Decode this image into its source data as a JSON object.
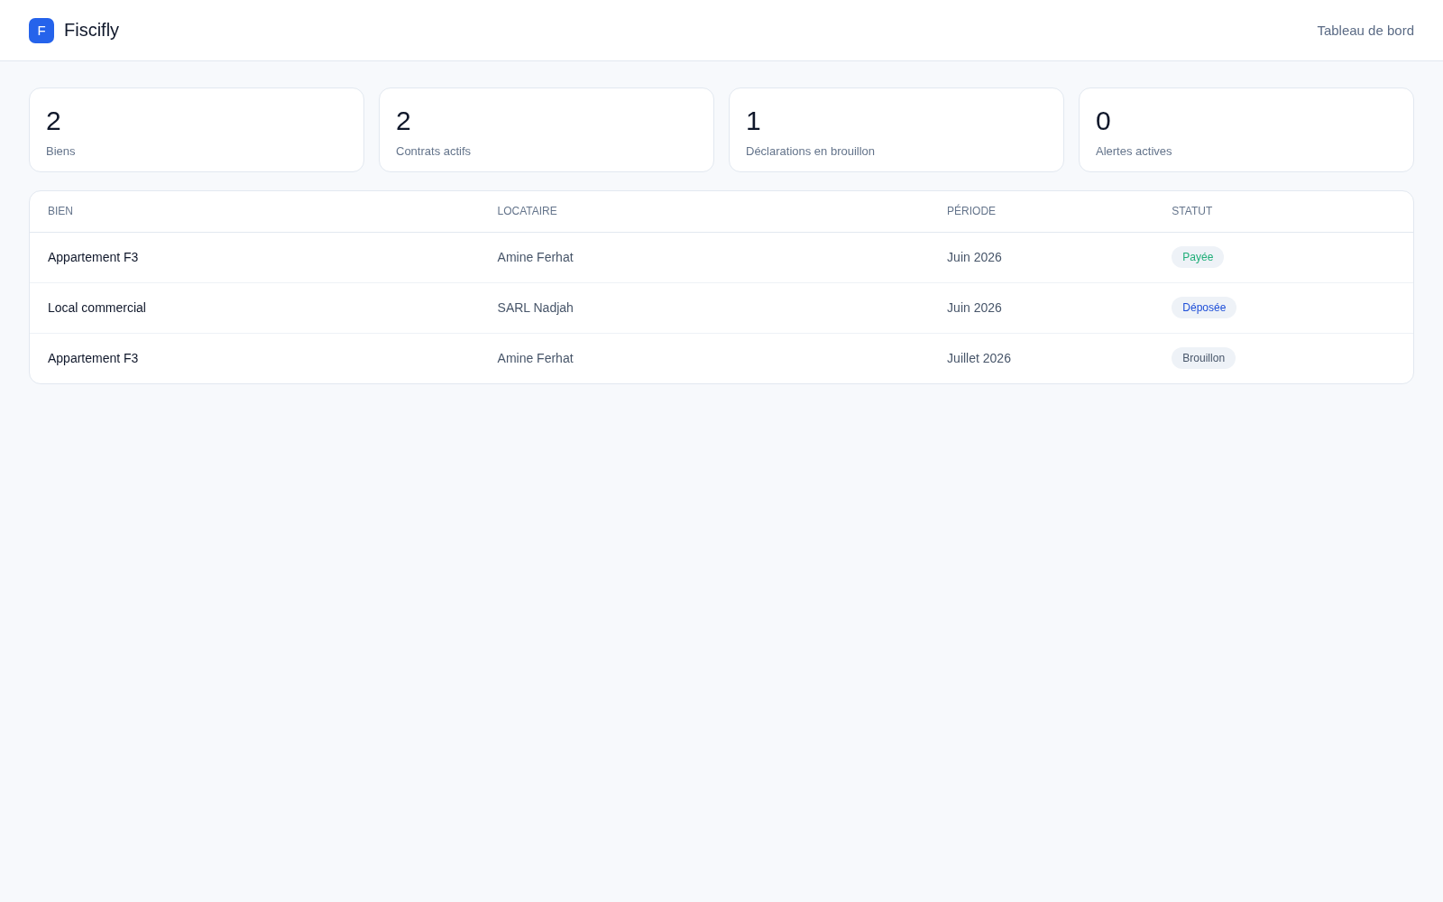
{
  "header": {
    "logo_letter": "F",
    "app_name": "Fiscifly",
    "nav": [
      {
        "label": "Tableau de bord"
      }
    ]
  },
  "stats": [
    {
      "value": "2",
      "label": "Biens"
    },
    {
      "value": "2",
      "label": "Contrats actifs"
    },
    {
      "value": "1",
      "label": "Déclarations en brouillon"
    },
    {
      "value": "0",
      "label": "Alertes actives"
    }
  ],
  "table": {
    "columns": [
      "BIEN",
      "LOCATAIRE",
      "PÉRIODE",
      "STATUT"
    ],
    "rows": [
      {
        "bien": "Appartement F3",
        "locataire": "Amine Ferhat",
        "periode": "Juin 2026",
        "status": {
          "label": "Payée",
          "color": "#1fae78"
        }
      },
      {
        "bien": "Local commercial",
        "locataire": "SARL Nadjah",
        "periode": "Juin 2026",
        "status": {
          "label": "Déposée",
          "color": "#1d4ed8"
        }
      },
      {
        "bien": "Appartement F3",
        "locataire": "Amine Ferhat",
        "periode": "Juillet 2026",
        "status": {
          "label": "Brouillon",
          "color": "#475569"
        }
      }
    ]
  }
}
